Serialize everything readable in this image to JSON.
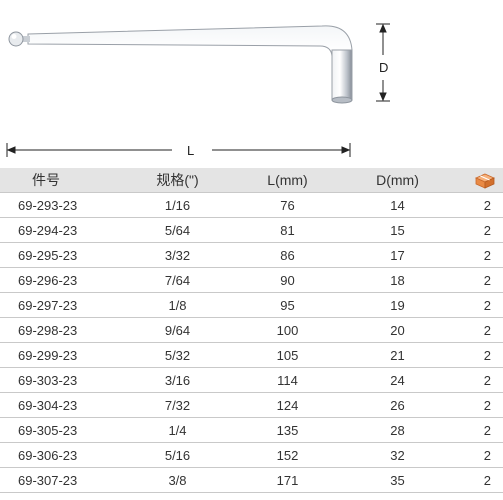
{
  "diagram": {
    "tool": "ball-end-hex-key",
    "dimension_d_label": "D",
    "dimension_l_label": "L"
  },
  "table": {
    "headers": {
      "part_no": "件号",
      "size": "规格(\")",
      "length": "L(mm)",
      "depth": "D(mm)",
      "qty_icon": "box-icon"
    },
    "rows": [
      {
        "part_no": "69-293-23",
        "size": "1/16",
        "length": "76",
        "depth": "14",
        "qty": "2"
      },
      {
        "part_no": "69-294-23",
        "size": "5/64",
        "length": "81",
        "depth": "15",
        "qty": "2"
      },
      {
        "part_no": "69-295-23",
        "size": "3/32",
        "length": "86",
        "depth": "17",
        "qty": "2"
      },
      {
        "part_no": "69-296-23",
        "size": "7/64",
        "length": "90",
        "depth": "18",
        "qty": "2"
      },
      {
        "part_no": "69-297-23",
        "size": "1/8",
        "length": "95",
        "depth": "19",
        "qty": "2"
      },
      {
        "part_no": "69-298-23",
        "size": "9/64",
        "length": "100",
        "depth": "20",
        "qty": "2"
      },
      {
        "part_no": "69-299-23",
        "size": "5/32",
        "length": "105",
        "depth": "21",
        "qty": "2"
      },
      {
        "part_no": "69-303-23",
        "size": "3/16",
        "length": "114",
        "depth": "24",
        "qty": "2"
      },
      {
        "part_no": "69-304-23",
        "size": "7/32",
        "length": "124",
        "depth": "26",
        "qty": "2"
      },
      {
        "part_no": "69-305-23",
        "size": "1/4",
        "length": "135",
        "depth": "28",
        "qty": "2"
      },
      {
        "part_no": "69-306-23",
        "size": "5/16",
        "length": "152",
        "depth": "32",
        "qty": "2"
      },
      {
        "part_no": "69-307-23",
        "size": "3/8",
        "length": "171",
        "depth": "35",
        "qty": "2"
      }
    ]
  }
}
